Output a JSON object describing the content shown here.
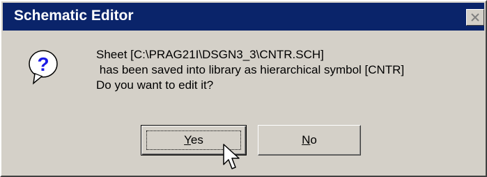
{
  "window": {
    "title": "Schematic Editor"
  },
  "icon": "question-icon",
  "message": {
    "line1": "Sheet [C:\\PRAG21I\\DSGN3_3\\CNTR.SCH]",
    "line2": " has been saved into library as hierarchical symbol [CNTR]",
    "line3": "Do you want to edit it?"
  },
  "buttons": {
    "yes": {
      "accel": "Y",
      "rest": "es"
    },
    "no": {
      "accel": "N",
      "rest": "o"
    }
  },
  "colors": {
    "titlebar": "#0a246a",
    "face": "#d4d0c8",
    "icon_blue": "#1a1ae6"
  }
}
